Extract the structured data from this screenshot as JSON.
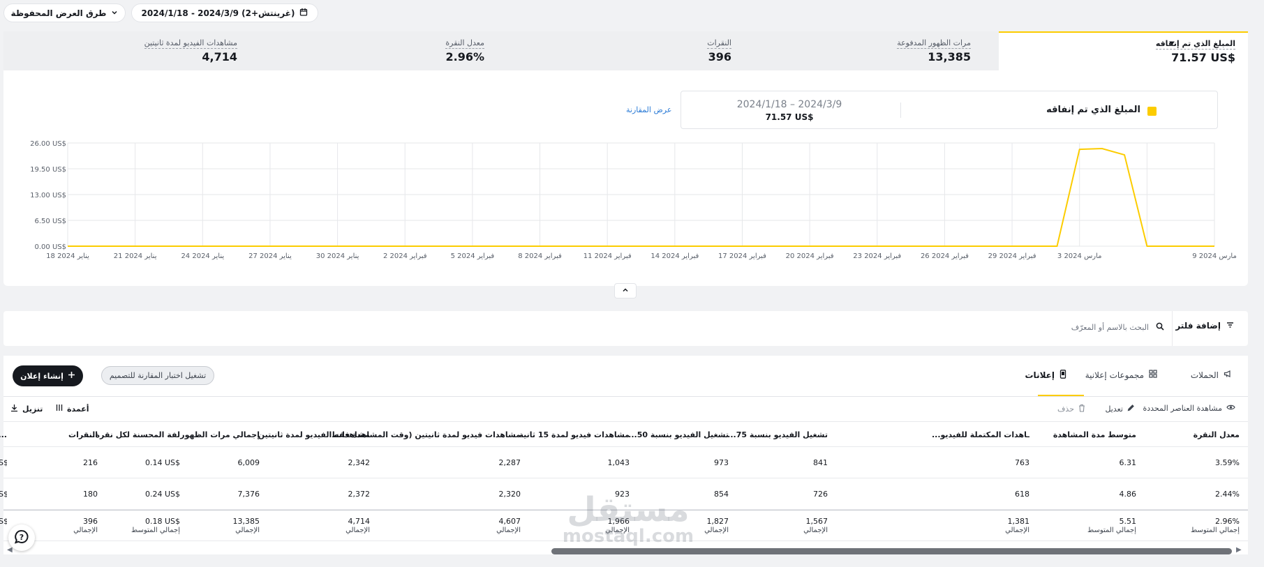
{
  "header": {
    "saved_views_label": "طرق العرض المحفوظة",
    "date_range": "2024/1/18 - 2024/3/9 (غرينتش+2)"
  },
  "metrics": [
    {
      "label": "المبلغ الذي تم إنفاقه",
      "value": "71.57 US$",
      "active": true
    },
    {
      "label": "مرات الظهور المدفوعة",
      "value": "13,385"
    },
    {
      "label": "النقرات",
      "value": "396"
    },
    {
      "label": "معدل النقرة",
      "value": "2.96%"
    },
    {
      "label": "مشاهدات الفيديو لمدة ثانيتين",
      "value": "4,714"
    }
  ],
  "legend": {
    "metric_name": "المبلغ الذي تم إنفاقه",
    "range": "2024/1/18 – 2024/3/9",
    "value": "71.57 US$",
    "compare_link": "عرض المقارنة"
  },
  "colors": {
    "accent": "#fccc00",
    "dark": "#16191f",
    "link": "#2b7bd6"
  },
  "chart_data": {
    "type": "line",
    "series": [
      {
        "name": "المبلغ الذي تم إنفاقه"
      }
    ],
    "x": [
      "2024-01-18",
      "2024-01-19",
      "2024-01-20",
      "2024-01-21",
      "2024-01-22",
      "2024-01-23",
      "2024-01-24",
      "2024-01-25",
      "2024-01-26",
      "2024-01-27",
      "2024-01-28",
      "2024-01-29",
      "2024-01-30",
      "2024-01-31",
      "2024-02-01",
      "2024-02-02",
      "2024-02-03",
      "2024-02-04",
      "2024-02-05",
      "2024-02-06",
      "2024-02-07",
      "2024-02-08",
      "2024-02-09",
      "2024-02-10",
      "2024-02-11",
      "2024-02-12",
      "2024-02-13",
      "2024-02-14",
      "2024-02-15",
      "2024-02-16",
      "2024-02-17",
      "2024-02-18",
      "2024-02-19",
      "2024-02-20",
      "2024-02-21",
      "2024-02-22",
      "2024-02-23",
      "2024-02-24",
      "2024-02-25",
      "2024-02-26",
      "2024-02-27",
      "2024-02-28",
      "2024-02-29",
      "2024-03-01",
      "2024-03-02",
      "2024-03-03",
      "2024-03-04",
      "2024-03-05",
      "2024-03-06",
      "2024-03-07",
      "2024-03-08",
      "2024-03-09"
    ],
    "y": [
      0,
      0,
      0,
      0,
      0,
      0,
      0,
      0,
      0,
      0,
      0,
      0,
      0,
      0,
      0,
      0,
      0,
      0,
      0,
      0,
      0,
      0,
      0,
      0,
      0,
      0,
      0,
      0,
      0,
      0,
      0,
      0,
      0,
      0,
      0,
      0,
      0,
      0,
      0,
      0,
      0,
      0,
      0,
      0,
      0,
      24.4,
      24.6,
      23.0,
      0,
      0,
      0,
      0
    ],
    "ylim": [
      0,
      26
    ],
    "y_ticks": [
      "0.00 US$",
      "6.50 US$",
      "13.00 US$",
      "19.50 US$",
      "26.00 US$"
    ],
    "x_ticks": [
      "18 يناير 2024",
      "21 يناير 2024",
      "24 يناير 2024",
      "27 يناير 2024",
      "30 يناير 2024",
      "2 فبراير 2024",
      "5 فبراير 2024",
      "8 فبراير 2024",
      "11 فبراير 2024",
      "14 فبراير 2024",
      "17 فبراير 2024",
      "20 فبراير 2024",
      "23 فبراير 2024",
      "26 فبراير 2024",
      "29 فبراير 2024",
      "3 مارس 2024",
      "9 مارس 2024"
    ],
    "grid": true
  },
  "collapse_icon": "chevron-up-icon",
  "filter": {
    "add_label": "إضافة فلتر",
    "search_placeholder": "البحث بالاسم أو المعرّف"
  },
  "tabs": {
    "campaigns": "الحملات",
    "adsets": "مجموعات إعلانية",
    "ads": "إعلانات"
  },
  "create_label": "إنشاء إعلان",
  "abtest_label": "تشغيل اختبار المقارنة للتصميم",
  "toolbar": {
    "view_selected": "مشاهدة العناصر المحددة",
    "edit": "تعديل",
    "delete": "حذف",
    "columns": "أعمدة",
    "download": "تنزيل"
  },
  "table": {
    "columns": [
      "معدل النقرة",
      "متوسط مدة المشاهدة",
      "...ـاهدات المكتملة للفيديو",
      "...تشغيل الفيديو بنسبة 75",
      "...تشغيل الفيديو بنسبة 50",
      "مشاهدات فيديو لمدة 15 ثانية",
      "مشاهدات فيديو لمدة ثانيتين (وقت المشاهدة فقط)",
      "مشاهدات الفيديو لمدة ثانيتين",
      "إجمالي مرات الظهور",
      "...لفة المحسنة لكل نقرة",
      "النقرات",
      "..."
    ],
    "rows": [
      [
        "3.59%",
        "6.31",
        "763",
        "841",
        "973",
        "1,043",
        "2,287",
        "2,342",
        "6,009",
        "0.14 US$",
        "216",
        "US$"
      ],
      [
        "2.44%",
        "4.86",
        "618",
        "726",
        "854",
        "923",
        "2,320",
        "2,372",
        "7,376",
        "0.24 US$",
        "180",
        "US$"
      ]
    ],
    "totals": [
      {
        "value": "2.96%",
        "sub": "إجمالي المتوسط"
      },
      {
        "value": "5.51",
        "sub": "إجمالي المتوسط"
      },
      {
        "value": "1,381",
        "sub": "الإجمالي"
      },
      {
        "value": "1,567",
        "sub": "الإجمالي"
      },
      {
        "value": "1,827",
        "sub": "الإجمالي"
      },
      {
        "value": "1,966",
        "sub": "الإجمالي"
      },
      {
        "value": "4,607",
        "sub": "الإجمالي"
      },
      {
        "value": "4,714",
        "sub": "الإجمالي"
      },
      {
        "value": "13,385",
        "sub": "الإجمالي"
      },
      {
        "value": "0.18 US$",
        "sub": "إجمالي المتوسط"
      },
      {
        "value": "396",
        "sub": "الإجمالي"
      },
      {
        "value": "US$",
        "sub": "ا"
      }
    ]
  },
  "watermark": {
    "arabic": "مستقل",
    "latin": "mostaql.com"
  }
}
